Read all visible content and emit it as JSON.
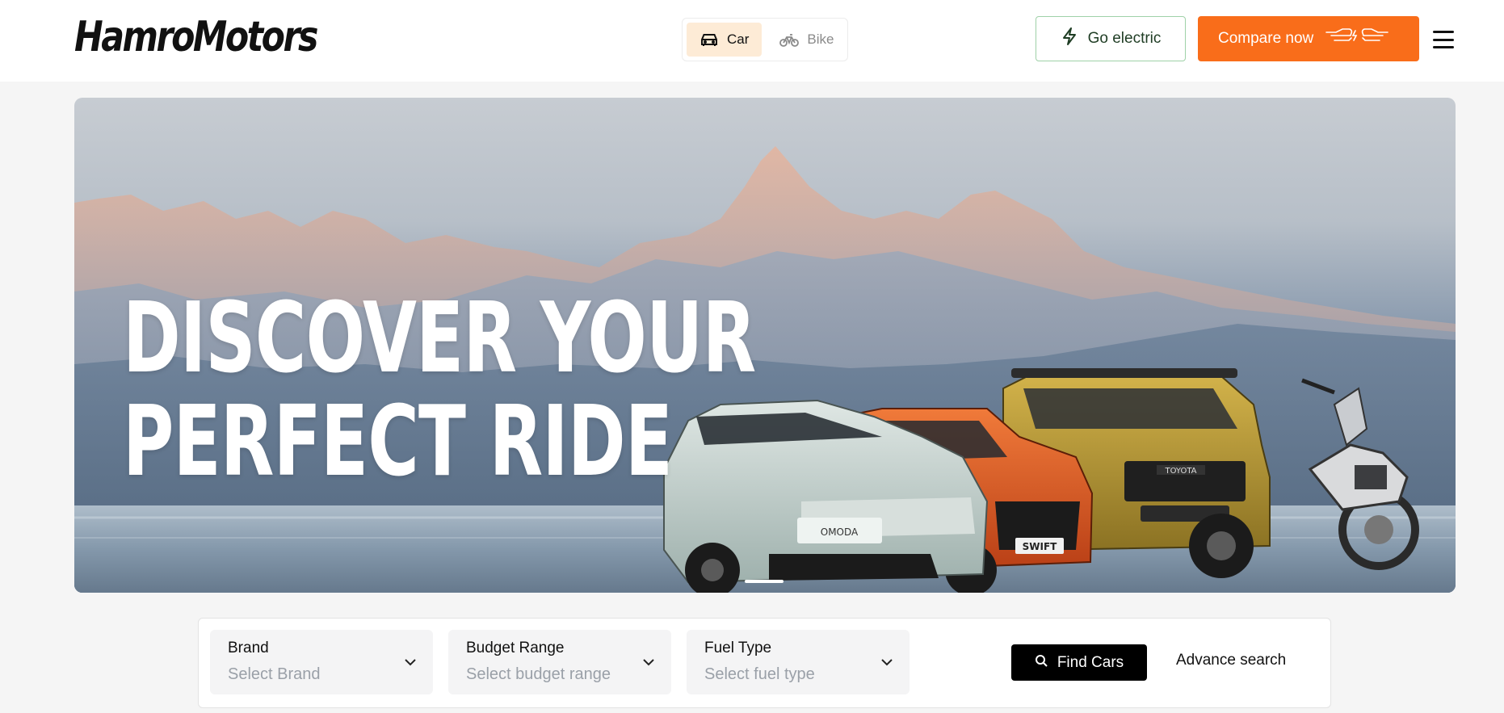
{
  "header": {
    "logo_text": "HamroMotors",
    "toggle": {
      "car_label": "Car",
      "bike_label": "Bike",
      "active": "car"
    },
    "go_electric_label": "Go electric",
    "compare_label": "Compare now"
  },
  "hero": {
    "title_line1": "DISCOVER YOUR",
    "title_line2": "PERFECT RIDE",
    "slides_count": 1,
    "active_slide": 1,
    "car_badges": [
      "OMODA",
      "SWIFT",
      "TOYOTA"
    ]
  },
  "search": {
    "brand": {
      "label": "Brand",
      "placeholder": "Select Brand"
    },
    "budget": {
      "label": "Budget Range",
      "placeholder": "Select budget range"
    },
    "fuel": {
      "label": "Fuel Type",
      "placeholder": "Select fuel type"
    },
    "find_label": "Find Cars",
    "advance_label": "Advance search"
  },
  "colors": {
    "accent": "#f96d1a",
    "toggle_active_bg": "#fdebd6",
    "electric_border": "#9fd1a8"
  }
}
